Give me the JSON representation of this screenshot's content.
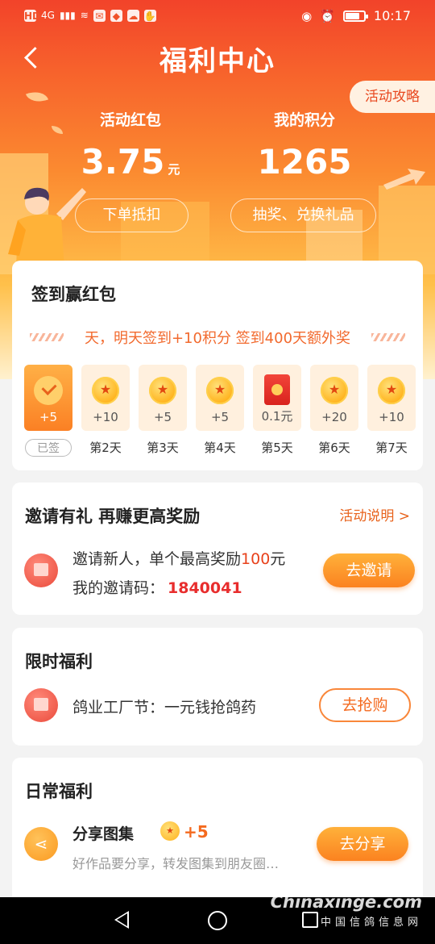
{
  "status_bar": {
    "left_items": [
      "HD",
      "4G",
      "▮▮▮",
      "wifi"
    ],
    "time": "10:17"
  },
  "header": {
    "title": "福利中心",
    "guide_button": "活动攻略",
    "red_packet": {
      "label": "活动红包",
      "value": "3.75",
      "unit": "元",
      "button": "下单抵扣"
    },
    "points": {
      "label": "我的积分",
      "value": "1265",
      "button": "抽奖、兑换礼品"
    }
  },
  "signin": {
    "title": "签到赢红包",
    "marquee": "天，明天签到+10积分 签到400天额外奖",
    "days": [
      {
        "amount": "+5",
        "label": "已签",
        "type": "done"
      },
      {
        "amount": "+10",
        "label": "第2天",
        "type": "coin"
      },
      {
        "amount": "+5",
        "label": "第3天",
        "type": "coin"
      },
      {
        "amount": "+5",
        "label": "第4天",
        "type": "coin"
      },
      {
        "amount": "0.1元",
        "label": "第5天",
        "type": "envelope"
      },
      {
        "amount": "+20",
        "label": "第6天",
        "type": "coin"
      },
      {
        "amount": "+10",
        "label": "第7天",
        "type": "coin"
      }
    ]
  },
  "invite": {
    "title": "邀请有礼  再赚更高奖励",
    "rules_link": "活动说明 >",
    "line1_prefix": "邀请新人，单个最高奖励",
    "line1_highlight": "100",
    "line1_suffix": "元",
    "code_label": "我的邀请码：",
    "code": "1840041",
    "button": "去邀请"
  },
  "limited": {
    "title": "限时福利",
    "item": "鸽业工厂节：一元钱抢鸽药",
    "button": "去抢购"
  },
  "daily": {
    "title": "日常福利",
    "share_title": "分享图集",
    "share_points": "+5",
    "share_desc": "好作品要分享，转发图集到朋友圈…",
    "button": "去分享"
  },
  "watermark": {
    "site": "Chinaxinge.com",
    "name": "中国信鸽信息网"
  },
  "colors": {
    "accent": "#f46a1f",
    "header_top": "#f2432a",
    "highlight_red": "#e82d2d"
  }
}
